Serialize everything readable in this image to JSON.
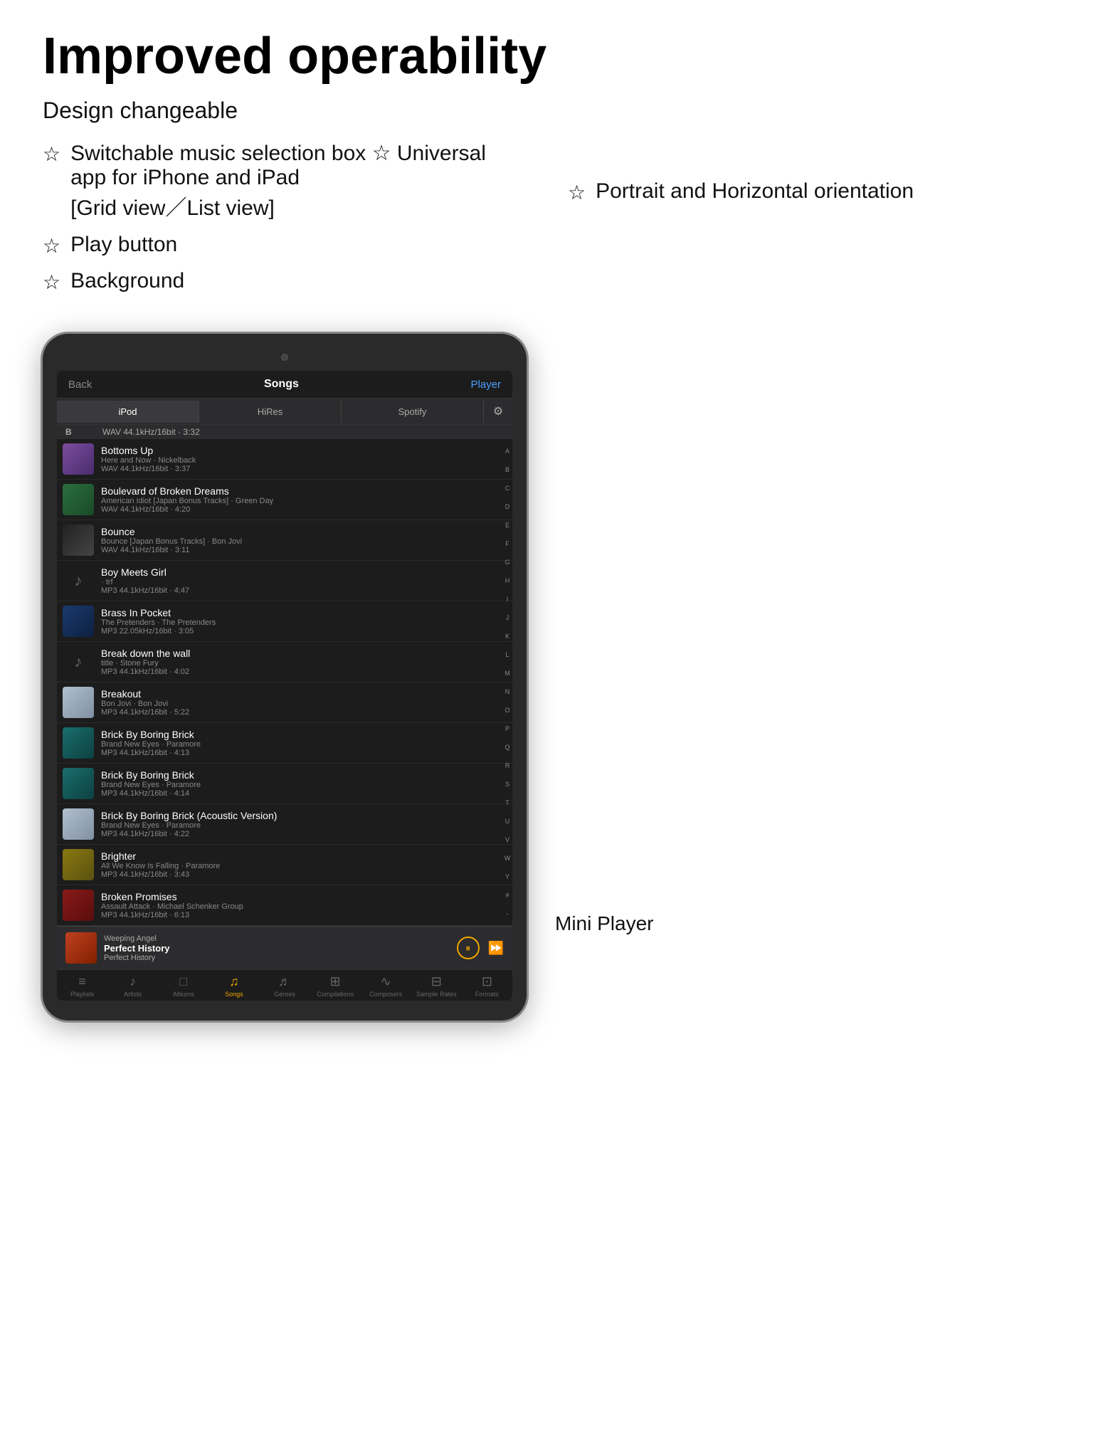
{
  "header": {
    "title": "Improved  operability",
    "subtitle": "Design changeable",
    "features_col1": [
      {
        "id": "feature-music-box",
        "text": "Switchable music selection box\n[Grid view／List view]"
      },
      {
        "id": "feature-play-button",
        "text": "Play button"
      },
      {
        "id": "feature-background",
        "text": "Background"
      }
    ],
    "features_col2": [
      {
        "id": "feature-universal",
        "text": "Universal app for iPhone and iPad"
      },
      {
        "id": "feature-orientation",
        "text": "Portrait and Horizontal orientation"
      }
    ]
  },
  "ipad": {
    "nav": {
      "back": "Back",
      "title": "Songs",
      "player": "Player"
    },
    "segments": [
      "iPod",
      "HiRes",
      "Spotify"
    ],
    "active_segment": "iPod",
    "section_label": "B",
    "songs": [
      {
        "id": "s1",
        "title": "Bottoms Up",
        "sub1": "Here and Now · Nickelback",
        "sub2": "WAV 44.1kHz/16bit · 3:37",
        "thumb": "purple",
        "has_thumb": true
      },
      {
        "id": "s2",
        "title": "Boulevard of Broken Dreams",
        "sub1": "American Idiot [Japan Bonus Tracks] · Green Day",
        "sub2": "WAV 44.1kHz/16bit · 4:20",
        "thumb": "green",
        "has_thumb": true
      },
      {
        "id": "s3",
        "title": "Bounce",
        "sub1": "Bounce [Japan Bonus Tracks] · Bon Jovi",
        "sub2": "WAV 44.1kHz/16bit · 3:11",
        "thumb": "dark",
        "has_thumb": true
      },
      {
        "id": "s4",
        "title": "Boy Meets Girl",
        "sub1": "· trf",
        "sub2": "MP3 44.1kHz/16bit · 4:47",
        "thumb": "",
        "has_thumb": false
      },
      {
        "id": "s5",
        "title": "Brass In Pocket",
        "sub1": "The Pretenders · The Pretenders",
        "sub2": "MP3 22.05kHz/16bit · 3:05",
        "thumb": "blue",
        "has_thumb": true
      },
      {
        "id": "s6",
        "title": "Break down the wall",
        "sub1": "title · Stone Fury",
        "sub2": "MP3 44.1kHz/16bit · 4:02",
        "thumb": "",
        "has_thumb": false
      },
      {
        "id": "s7",
        "title": "Breakout",
        "sub1": "Bon Jovi · Bon Jovi",
        "sub2": "MP3 44.1kHz/16bit · 5:22",
        "thumb": "snow",
        "has_thumb": true
      },
      {
        "id": "s8",
        "title": "Brick By Boring Brick",
        "sub1": "Brand New Eyes · Paramore",
        "sub2": "MP3 44.1kHz/16bit · 4:13",
        "thumb": "teal",
        "has_thumb": true
      },
      {
        "id": "s9",
        "title": "Brick By Boring Brick",
        "sub1": "Brand New Eyes · Paramore",
        "sub2": "MP3 44.1kHz/16bit · 4:14",
        "thumb": "teal",
        "has_thumb": true
      },
      {
        "id": "s10",
        "title": "Brick By Boring Brick (Acoustic Version)",
        "sub1": "Brand New Eyes · Paramore",
        "sub2": "MP3 44.1kHz/16bit · 4:22",
        "thumb": "snow",
        "has_thumb": true
      },
      {
        "id": "s11",
        "title": "Brighter",
        "sub1": "All We Know Is Falling · Paramore",
        "sub2": "MP3 44.1kHz/16bit · 3:43",
        "thumb": "yellow",
        "has_thumb": true
      },
      {
        "id": "s12",
        "title": "Broken Promises",
        "sub1": "Assault Attack · Michael Schenker Group",
        "sub2": "MP3 44.1kHz/16bit · 6:13",
        "thumb": "red",
        "has_thumb": true
      }
    ],
    "alpha_index": [
      "A",
      "B",
      "C",
      "D",
      "E",
      "F",
      "G",
      "H",
      "I",
      "J",
      "K",
      "L",
      "M",
      "N",
      "O",
      "P",
      "Q",
      "R",
      "S",
      "T",
      "U",
      "V",
      "W",
      "Y",
      "#",
      "-"
    ],
    "section_b_label": "B",
    "section_b_sub": "WAV 44.1kHz/16bit · 3:32",
    "mini_player": {
      "thumb": "sunset",
      "artist_line": "Weeping Angel",
      "song": "Perfect History",
      "album": "Perfect History"
    },
    "tabs": [
      {
        "id": "tab-playlists",
        "icon": "≡",
        "label": "Playlists",
        "active": false
      },
      {
        "id": "tab-artists",
        "icon": "♪",
        "label": "Artists",
        "active": false
      },
      {
        "id": "tab-albums",
        "icon": "□",
        "label": "Albums",
        "active": false
      },
      {
        "id": "tab-songs",
        "icon": "♫",
        "label": "Songs",
        "active": true
      },
      {
        "id": "tab-genres",
        "icon": "♬",
        "label": "Genres",
        "active": false
      },
      {
        "id": "tab-compilations",
        "icon": "⊞",
        "label": "Compilations",
        "active": false
      },
      {
        "id": "tab-composers",
        "icon": "∿",
        "label": "Composers",
        "active": false
      },
      {
        "id": "tab-samplerates",
        "icon": "⊟",
        "label": "Sample Rates",
        "active": false
      },
      {
        "id": "tab-formats",
        "icon": "⊡",
        "label": "Formats",
        "active": false
      }
    ]
  },
  "side_label": "Mini Player"
}
